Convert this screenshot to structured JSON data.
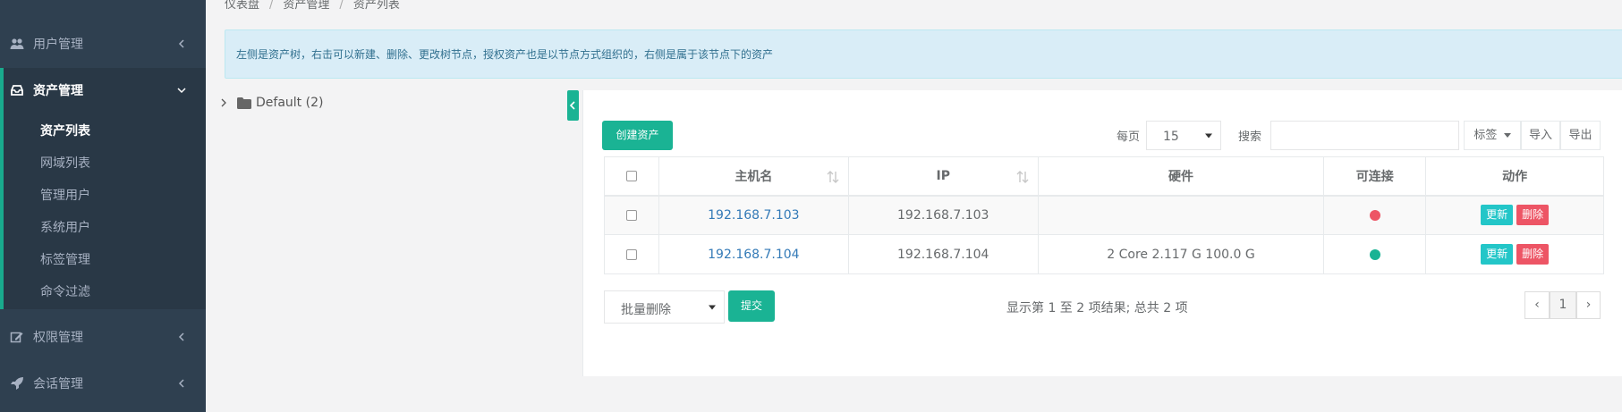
{
  "breadcrumb": [
    "仪表盘",
    "资产管理",
    "资产列表"
  ],
  "sidebar": {
    "items": [
      {
        "label": "用户管理",
        "icon": "users-icon"
      },
      {
        "label": "资产管理",
        "icon": "inbox-icon"
      },
      {
        "label": "权限管理",
        "icon": "edit-icon"
      },
      {
        "label": "会话管理",
        "icon": "rocket-icon"
      }
    ],
    "sub_items": [
      "资产列表",
      "网域列表",
      "管理用户",
      "系统用户",
      "标签管理",
      "命令过滤"
    ]
  },
  "alert": {
    "text": "左侧是资产树，右击可以新建、删除、更改树节点，授权资产也是以节点方式组织的，右侧是属于该节点下的资产"
  },
  "tree": {
    "root_label": "Default (2)"
  },
  "toolbar": {
    "create_label": "创建资产",
    "per_page_label": "每页",
    "per_page_value": "15",
    "search_label": "搜索",
    "search_value": "",
    "tags_label": "标签",
    "import_label": "导入",
    "export_label": "导出"
  },
  "table": {
    "headers": [
      "主机名",
      "IP",
      "硬件",
      "可连接",
      "动作"
    ],
    "rows": [
      {
        "hostname": "192.168.7.103",
        "ip": "192.168.7.103",
        "hardware": "",
        "connectable": false
      },
      {
        "hostname": "192.168.7.104",
        "ip": "192.168.7.104",
        "hardware": "2 Core 2.117 G 100.0 G",
        "connectable": true
      }
    ],
    "update_label": "更新",
    "delete_label": "删除"
  },
  "footer": {
    "bulk_action": "批量删除",
    "submit_label": "提交",
    "info": "显示第 1 至 2 项结果; 总共 2 项",
    "prev": "‹",
    "page": "1",
    "next": "›"
  },
  "colors": {
    "sidebar_bg": "#2f4050",
    "accent": "#1ab394",
    "link": "#337ab7",
    "status_offline": "#ed5565",
    "status_online": "#1ab394",
    "update_btn": "#23c6c8",
    "delete_btn": "#ed5565"
  }
}
